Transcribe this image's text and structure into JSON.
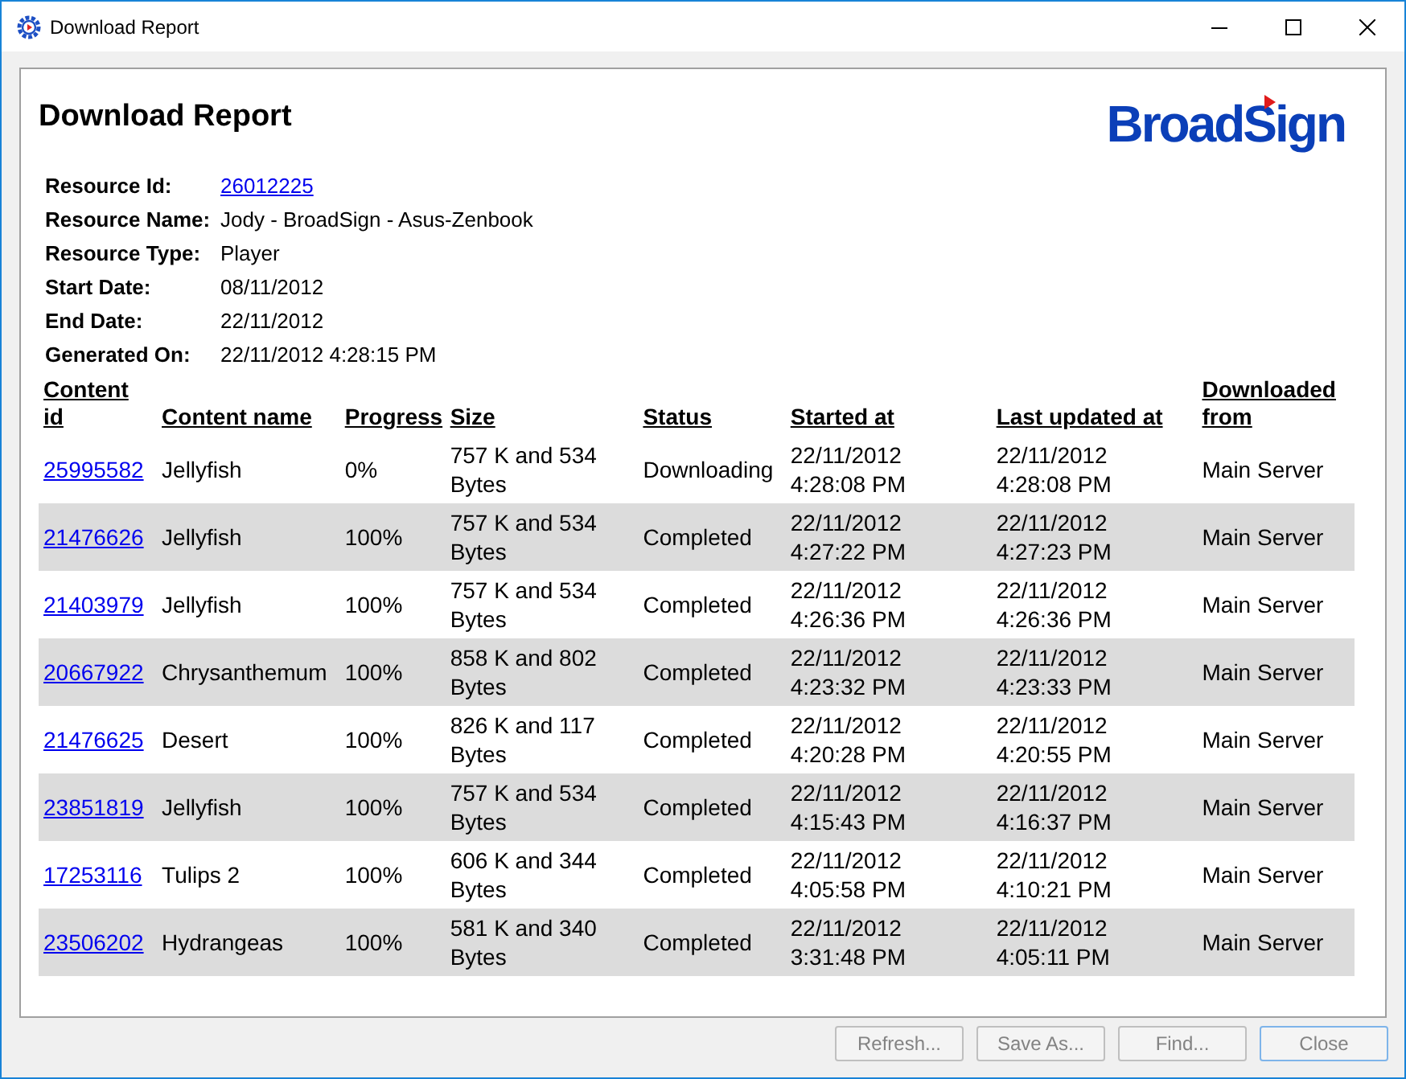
{
  "window": {
    "title": "Download Report"
  },
  "report": {
    "heading": "Download Report",
    "logo": "BroadSign",
    "info": [
      {
        "label": "Resource Id:",
        "value": "26012225",
        "kind": "link"
      },
      {
        "label": "Resource Name:",
        "value": "Jody - BroadSign - Asus-Zenbook",
        "kind": "text"
      },
      {
        "label": "Resource Type:",
        "value": "Player",
        "kind": "text"
      },
      {
        "label": "Start Date:",
        "value": "08/11/2012",
        "kind": "text"
      },
      {
        "label": "End Date:",
        "value": "22/11/2012",
        "kind": "text"
      },
      {
        "label": "Generated On:",
        "value": "22/11/2012 4:28:15 PM",
        "kind": "text"
      }
    ],
    "table": {
      "columns": [
        "Content id",
        "Content name",
        "Progress",
        "Size",
        "Status",
        "Started at",
        "Last updated at",
        "Downloaded from"
      ],
      "rows": [
        [
          "25995582",
          "Jellyfish",
          "0%",
          "757 K and 534 Bytes",
          "Downloading",
          "22/11/2012 4:28:08 PM",
          "22/11/2012 4:28:08 PM",
          "Main Server"
        ],
        [
          "21476626",
          "Jellyfish",
          "100%",
          "757 K and 534 Bytes",
          "Completed",
          "22/11/2012 4:27:22 PM",
          "22/11/2012 4:27:23 PM",
          "Main Server"
        ],
        [
          "21403979",
          "Jellyfish",
          "100%",
          "757 K and 534 Bytes",
          "Completed",
          "22/11/2012 4:26:36 PM",
          "22/11/2012 4:26:36 PM",
          "Main Server"
        ],
        [
          "20667922",
          "Chrysanthemum",
          "100%",
          "858 K and 802 Bytes",
          "Completed",
          "22/11/2012 4:23:32 PM",
          "22/11/2012 4:23:33 PM",
          "Main Server"
        ],
        [
          "21476625",
          "Desert",
          "100%",
          "826 K and 117 Bytes",
          "Completed",
          "22/11/2012 4:20:28 PM",
          "22/11/2012 4:20:55 PM",
          "Main Server"
        ],
        [
          "23851819",
          "Jellyfish",
          "100%",
          "757 K and 534 Bytes",
          "Completed",
          "22/11/2012 4:15:43 PM",
          "22/11/2012 4:16:37 PM",
          "Main Server"
        ],
        [
          "17253116",
          "Tulips 2",
          "100%",
          "606 K and 344 Bytes",
          "Completed",
          "22/11/2012 4:05:58 PM",
          "22/11/2012 4:10:21 PM",
          "Main Server"
        ],
        [
          "23506202",
          "Hydrangeas",
          "100%",
          "581 K and 340 Bytes",
          "Completed",
          "22/11/2012 3:31:48 PM",
          "22/11/2012 4:05:11 PM",
          "Main Server"
        ]
      ]
    }
  },
  "buttons": [
    {
      "label": "Refresh...",
      "disabled": true,
      "default": false
    },
    {
      "label": "Save As...",
      "disabled": true,
      "default": false
    },
    {
      "label": "Find...",
      "disabled": true,
      "default": false
    },
    {
      "label": "Close",
      "disabled": true,
      "default": true
    }
  ]
}
